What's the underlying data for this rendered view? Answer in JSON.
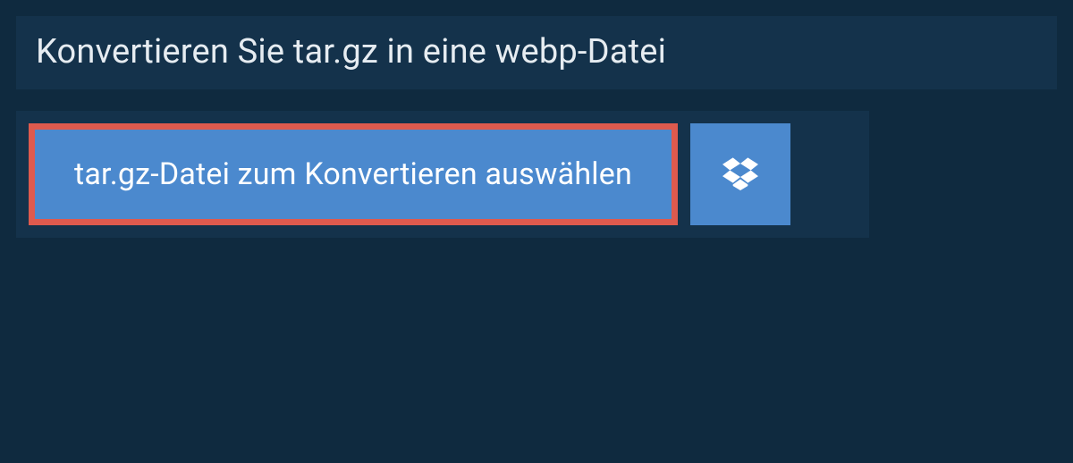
{
  "heading": "Konvertieren Sie tar.gz in eine webp-Datei",
  "file_button_label": "tar.gz-Datei zum Konvertieren auswählen",
  "colors": {
    "page_bg": "#0f2a3f",
    "panel_bg": "#14324b",
    "button_bg": "#4b89ce",
    "highlight_border": "#de5a4e",
    "text_light": "#e6ecf1"
  }
}
